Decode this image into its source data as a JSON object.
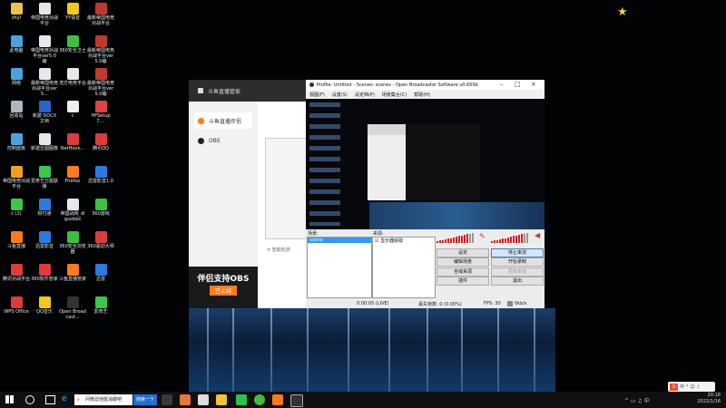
{
  "desktop": {
    "icons": [
      {
        "label": "zhyi",
        "color": "#f0c24b"
      },
      {
        "label": "帝国电竞对战平台",
        "color": "#e8e8e8"
      },
      {
        "label": "YY语音",
        "color": "#f2c81c"
      },
      {
        "label": "最新帝国电竞对战平台",
        "color": "#c0392b"
      },
      {
        "label": "此电脑",
        "color": "#4aa3df"
      },
      {
        "label": "帝国电竞对战平台ver5.0编",
        "color": "#e8e8e8"
      },
      {
        "label": "360安全卫士",
        "color": "#3fbf3f"
      },
      {
        "label": "最新帝国电竞对战平台ver5.0编",
        "color": "#c0392b"
      },
      {
        "label": "网络",
        "color": "#4aa3df"
      },
      {
        "label": "最新帝国电竞对战平台ver5...",
        "color": "#e8e8e8"
      },
      {
        "label": "浩方电竞平台",
        "color": "#e8e8e8"
      },
      {
        "label": "最新帝国电竞对战平台ver5.0编",
        "color": "#c0392b"
      },
      {
        "label": "回收站",
        "color": "#aeb6bf"
      },
      {
        "label": "新建 DOCX 文档",
        "color": "#2b64c8"
      },
      {
        "label": "c",
        "color": "#f0f0f0"
      },
      {
        "label": "HFSetup7....",
        "color": "#d44"
      },
      {
        "label": "控制面板",
        "color": "#4aa3df"
      },
      {
        "label": "新建位图图像",
        "color": "#e8e8e8"
      },
      {
        "label": "NetHook...",
        "color": "#e03a3a"
      },
      {
        "label": "腾讯QQ",
        "color": "#e03a3a"
      },
      {
        "label": "帝国电竞对战平台",
        "color": "#f0a020"
      },
      {
        "label": "爱奇艺万能联播",
        "color": "#39c84a"
      },
      {
        "label": "Firefox",
        "color": "#ff7a1a"
      },
      {
        "label": "迅雷影音1.0",
        "color": "#2b7ae0"
      },
      {
        "label": "c (2)",
        "color": "#39c84a"
      },
      {
        "label": "财付通",
        "color": "#2b7ae0"
      },
      {
        "label": "帝国战网_dlguobbs",
        "color": "#e8e8e8"
      },
      {
        "label": "360游戏",
        "color": "#3fbf3f"
      },
      {
        "label": "斗鱼直播",
        "color": "#ff7a1a"
      },
      {
        "label": "迅雷影音",
        "color": "#2b7ae0"
      },
      {
        "label": "360安全浏览器",
        "color": "#3fbf3f"
      },
      {
        "label": "360驱动大师",
        "color": "#e03a3a"
      },
      {
        "label": "腾讯对战平台",
        "color": "#e03a3a"
      },
      {
        "label": "360软件管家",
        "color": "#e03a3a"
      },
      {
        "label": "斗鱼直播管家",
        "color": "#ff7a1a"
      },
      {
        "label": "迅雷",
        "color": "#2b7ae0"
      },
      {
        "label": "WPS Office",
        "color": "#e03a3a"
      },
      {
        "label": "QQ音乐",
        "color": "#f2c81c"
      },
      {
        "label": "Open Broadcast...",
        "color": "#333333"
      },
      {
        "label": "爱奇艺",
        "color": "#39c84a"
      }
    ]
  },
  "douyu": {
    "title": "斗鱼直播管家",
    "nav": [
      {
        "label": "斗鱼直播伴侣"
      },
      {
        "label": "OBS"
      }
    ],
    "help": "智能检测",
    "promo_line1": "伴侣支持OBS",
    "promo_line2": "已上线",
    "brand_color": "#ff7a1a"
  },
  "obs": {
    "title": "Profile: Untitled - Scenes: scenes - Open Broadcaster Software v0.659b",
    "menu": [
      "视图(F)",
      "设置(S)",
      "设定档(P)",
      "场景集合(C)",
      "帮助(H)"
    ],
    "scenes_label": "场景:",
    "sources_label": "来源:",
    "scene_item": "scene",
    "source_item": "显示器获取",
    "buttons": {
      "settings": "设定",
      "stop_stream": "停止串流",
      "edit_scene": "编辑场景",
      "start_record": "开始录制",
      "global_sources": "全域来源",
      "preview_stream": "预览串流",
      "plugins": "插件",
      "exit": "退出"
    },
    "status": {
      "time": "0:00:05 (LIVE)",
      "dropped": "丢失帧数: 0 (0.00%)",
      "fps": "FPS: 30",
      "bitrate": "0kb/s"
    }
  },
  "taskbar": {
    "search_placeholder": "问微滤他能消做吧",
    "search_button": "搜索一下",
    "time": "20:18",
    "date": "2022/1/16",
    "ime": "中"
  }
}
